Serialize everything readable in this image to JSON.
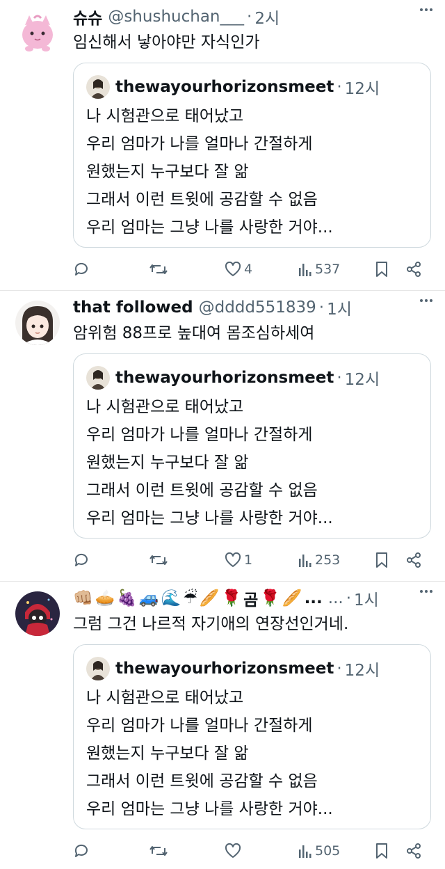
{
  "colors": {
    "text": "#0f1419",
    "muted": "#536471",
    "border": "#cfd9de",
    "divider": "#e6e6e6"
  },
  "tweets": [
    {
      "name": "슈슈",
      "handle": "@shushuchan___",
      "dot": "·",
      "time": "2시",
      "text": "임신해서 낳아야만 자식인가",
      "avatar": "pink-pokemon-avatar",
      "quote": {
        "name": "thewayourhorizonsmeet",
        "dot": "·",
        "time": "12시",
        "lines": [
          "나 시험관으로 태어났고",
          "우리 엄마가 나를 얼마나 간절하게",
          "원했는지 누구보다 잘 앎",
          "그래서 이런 트윗에 공감할 수 없음",
          "우리 엄마는 그냥 나를 사랑한 거야..."
        ]
      },
      "actions": {
        "reply": "",
        "retweet": "",
        "likes": "4",
        "views": "537"
      }
    },
    {
      "name": "that followed",
      "handle": "@dddd551839",
      "dot": "·",
      "time": "1시",
      "text": "암위험 88프로 높대여 몸조심하세여",
      "avatar": "anime-girl-avatar",
      "quote": {
        "name": "thewayourhorizonsmeet",
        "dot": "·",
        "time": "12시",
        "lines": [
          "나 시험관으로 태어났고",
          "우리 엄마가 나를 얼마나 간절하게",
          "원했는지 누구보다 잘 앎",
          "그래서 이런 트윗에 공감할 수 없음",
          "우리 엄마는 그냥 나를 사랑한 거야..."
        ]
      },
      "actions": {
        "reply": "",
        "retweet": "",
        "likes": "1",
        "views": "253"
      }
    },
    {
      "name_emojis": [
        "👊🏼",
        "🥧",
        "🍇",
        "🚙",
        "🌊",
        "☔",
        "🥖",
        "🌹",
        "곰",
        "🌹",
        "🥖",
        "..."
      ],
      "handle": "...",
      "dot": "·",
      "time": "1시",
      "text": "그럼 그건 나르적 자기애의 연장선인거네.",
      "avatar": "red-hood-character-avatar",
      "quote": {
        "name": "thewayourhorizonsmeet",
        "dot": "·",
        "time": "12시",
        "lines": [
          "나 시험관으로 태어났고",
          "우리 엄마가 나를 얼마나 간절하게",
          "원했는지 누구보다 잘 앎",
          "그래서 이런 트윗에 공감할 수 없음",
          "우리 엄마는 그냥 나를 사랑한 거야..."
        ]
      },
      "actions": {
        "reply": "",
        "retweet": "",
        "likes": "",
        "views": "505"
      }
    }
  ]
}
